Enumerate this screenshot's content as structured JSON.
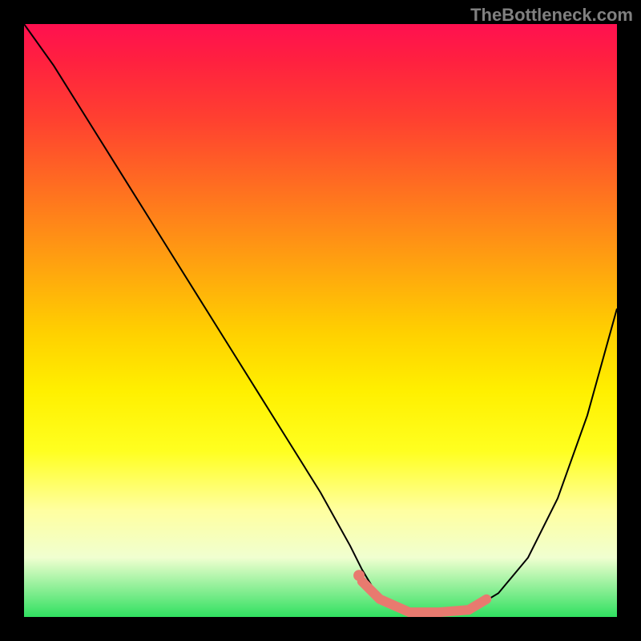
{
  "watermark": "TheBottleneck.com",
  "chart_data": {
    "type": "line",
    "title": "",
    "xlabel": "",
    "ylabel": "",
    "x_range": [
      0,
      100
    ],
    "y_range": [
      0,
      100
    ],
    "series": [
      {
        "name": "main-curve",
        "color": "#000000",
        "x": [
          0,
          5,
          10,
          15,
          20,
          25,
          30,
          35,
          40,
          45,
          50,
          55,
          57,
          60,
          65,
          70,
          75,
          80,
          85,
          90,
          95,
          100
        ],
        "y": [
          100,
          93,
          85,
          77,
          69,
          61,
          53,
          45,
          37,
          29,
          21,
          12,
          8,
          3,
          0.5,
          0.5,
          1,
          4,
          10,
          20,
          34,
          52
        ]
      },
      {
        "name": "highlight-segment",
        "color": "#e87a6f",
        "x": [
          57,
          60,
          65,
          70,
          75,
          78
        ],
        "y": [
          6,
          3,
          0.8,
          0.8,
          1.2,
          3
        ]
      },
      {
        "name": "highlight-dot",
        "color": "#e87a6f",
        "x": [
          56.5
        ],
        "y": [
          7
        ]
      }
    ],
    "gradient_stops": [
      {
        "pos": 0,
        "color": "#ff1050"
      },
      {
        "pos": 50,
        "color": "#ffe000"
      },
      {
        "pos": 100,
        "color": "#30e060"
      }
    ]
  }
}
